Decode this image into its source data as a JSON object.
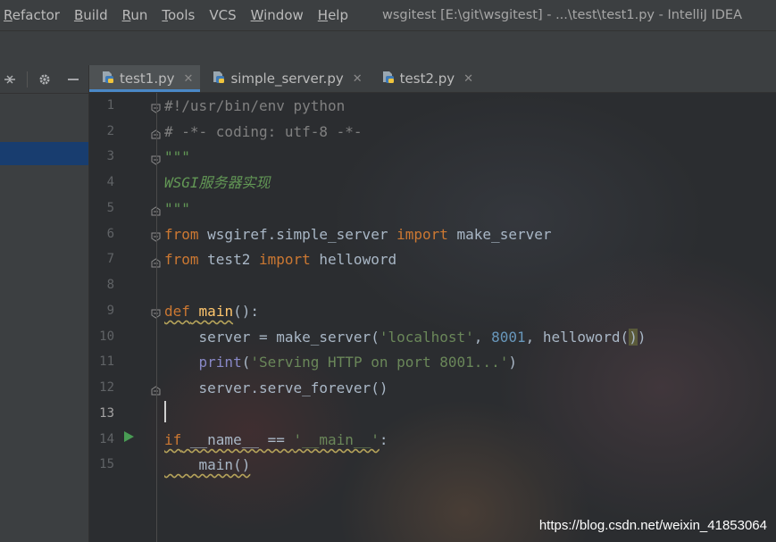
{
  "menu": {
    "items": [
      {
        "mnemonic": "R",
        "rest": "efactor"
      },
      {
        "mnemonic": "B",
        "rest": "uild"
      },
      {
        "mnemonic": "R",
        "rest": "un",
        "mnemonic_first": true
      },
      {
        "mnemonic": "T",
        "rest": "ools"
      },
      {
        "mnemonic": "",
        "rest": "VCS"
      },
      {
        "mnemonic": "W",
        "rest": "indow"
      },
      {
        "mnemonic": "H",
        "rest": "elp"
      }
    ],
    "window_title": "wsgitest [E:\\git\\wsgitest] - ...\\test\\test1.py - IntelliJ IDEA"
  },
  "left_toolbar": {
    "icons": [
      "collapse-all-icon",
      "gear-icon",
      "hide-panel-icon"
    ]
  },
  "tabs": [
    {
      "label": "test1.py",
      "active": true,
      "icon": "python-file-icon"
    },
    {
      "label": "simple_server.py",
      "active": false,
      "icon": "python-file-icon"
    },
    {
      "label": "test2.py",
      "active": false,
      "icon": "python-file-icon"
    }
  ],
  "editor": {
    "current_line": 13,
    "run_line": 14,
    "lines": [
      {
        "n": "1"
      },
      {
        "n": "2"
      },
      {
        "n": "3"
      },
      {
        "n": "4"
      },
      {
        "n": "5"
      },
      {
        "n": "6"
      },
      {
        "n": "7"
      },
      {
        "n": "8"
      },
      {
        "n": "9"
      },
      {
        "n": "10"
      },
      {
        "n": "11"
      },
      {
        "n": "12"
      },
      {
        "n": "13"
      },
      {
        "n": "14"
      },
      {
        "n": "15"
      }
    ],
    "code": {
      "l1": "#!/usr/bin/env python",
      "l2": "# -*- coding: utf-8 -*-",
      "l3": "\"\"\"",
      "l4": "WSGI服务器实现",
      "l5": "\"\"\"",
      "l6_kw1": "from",
      "l6_mod": " wsgiref.simple_server ",
      "l6_kw2": "import",
      "l6_name": " make_server",
      "l7_kw1": "from",
      "l7_mod": " test2 ",
      "l7_kw2": "import",
      "l7_name": " helloword",
      "l9_kw": "def",
      "l9_sp": " ",
      "l9_fn": "main",
      "l9_rest": "():",
      "l10_a": "    server = make_server(",
      "l10_str": "'localhost'",
      "l10_b": ", ",
      "l10_num": "8001",
      "l10_c": ", helloword(",
      "l10_d": ")",
      "l10_e": ")",
      "l11_indent": "    ",
      "l11_fn": "print",
      "l11_a": "(",
      "l11_str": "'Serving HTTP on port 8001...'",
      "l11_b": ")",
      "l12": "    server.serve_forever()",
      "l14_kw": "if",
      "l14_a": " __name__ == ",
      "l14_str": "'__main__'",
      "l14_b": ":",
      "l15": "    main()"
    }
  },
  "watermark": "https://blog.csdn.net/weixin_41853064",
  "colors": {
    "keyword": "#cc7832",
    "string": "#6a8759",
    "number": "#6897bb",
    "function": "#ffc66d",
    "comment": "#808080",
    "docstring": "#629755",
    "builtin": "#8888c6",
    "active_tab_underline": "#4a88c7",
    "run_icon": "#499c54"
  }
}
